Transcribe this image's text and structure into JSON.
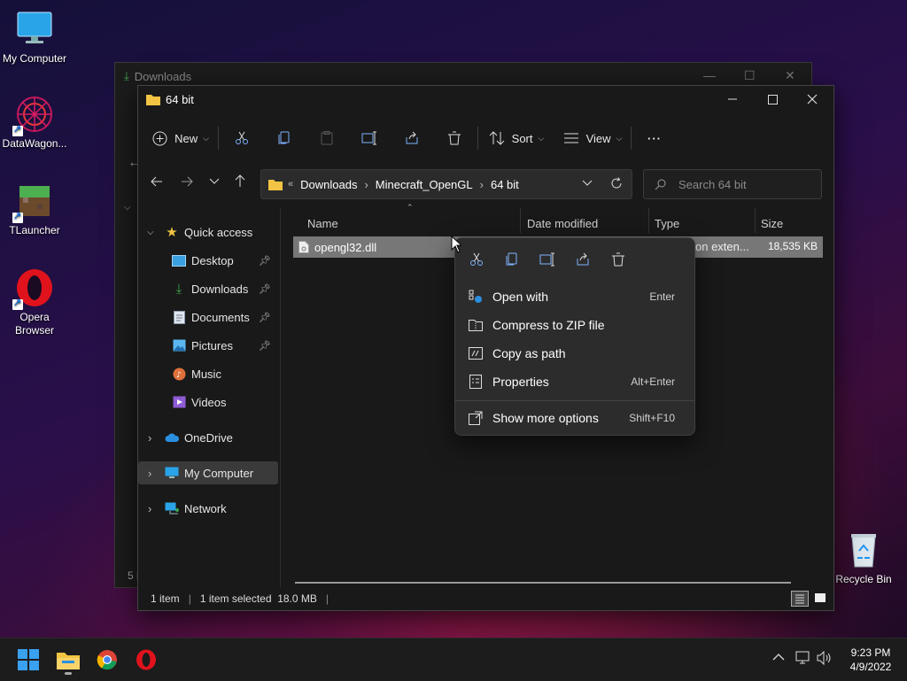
{
  "desktop": {
    "icons": [
      {
        "label": "My Computer"
      },
      {
        "label": "DataWagon..."
      },
      {
        "label": "TLauncher"
      },
      {
        "label": "Opera Browser"
      },
      {
        "label": "Recycle Bin"
      }
    ]
  },
  "back_window": {
    "title": "Downloads",
    "status_prefix": "5 i"
  },
  "window": {
    "title": "64 bit",
    "toolbar": {
      "new_label": "New",
      "sort_label": "Sort",
      "view_label": "View",
      "more_label": "···"
    },
    "breadcrumb": {
      "overflow": "«",
      "parts": [
        "Downloads",
        "Minecraft_OpenGL",
        "64 bit"
      ]
    },
    "search": {
      "placeholder": "Search 64 bit"
    },
    "nav": {
      "quick_access": "Quick access",
      "items": [
        {
          "label": "Desktop"
        },
        {
          "label": "Downloads"
        },
        {
          "label": "Documents"
        },
        {
          "label": "Pictures"
        },
        {
          "label": "Music"
        },
        {
          "label": "Videos"
        }
      ],
      "onedrive": "OneDrive",
      "my_computer": "My Computer",
      "network": "Network"
    },
    "columns": {
      "name": "Name",
      "date": "Date modified",
      "type": "Type",
      "size": "Size"
    },
    "files": [
      {
        "name": "opengl32.dll",
        "type": "on exten...",
        "size": "18,535 KB"
      }
    ],
    "status": {
      "count": "1 item",
      "selected": "1 item selected  18.0 MB"
    }
  },
  "context_menu": {
    "items": [
      {
        "label": "Open with",
        "shortcut": "Enter"
      },
      {
        "label": "Compress to ZIP file",
        "shortcut": ""
      },
      {
        "label": "Copy as path",
        "shortcut": ""
      },
      {
        "label": "Properties",
        "shortcut": "Alt+Enter"
      },
      {
        "label": "Show more options",
        "shortcut": "Shift+F10"
      }
    ]
  },
  "taskbar": {
    "time": "9:23 PM",
    "date": "4/9/2022"
  },
  "colors": {
    "accent": "#0078d4",
    "folder": "#f3c443",
    "selection": "#777777"
  }
}
